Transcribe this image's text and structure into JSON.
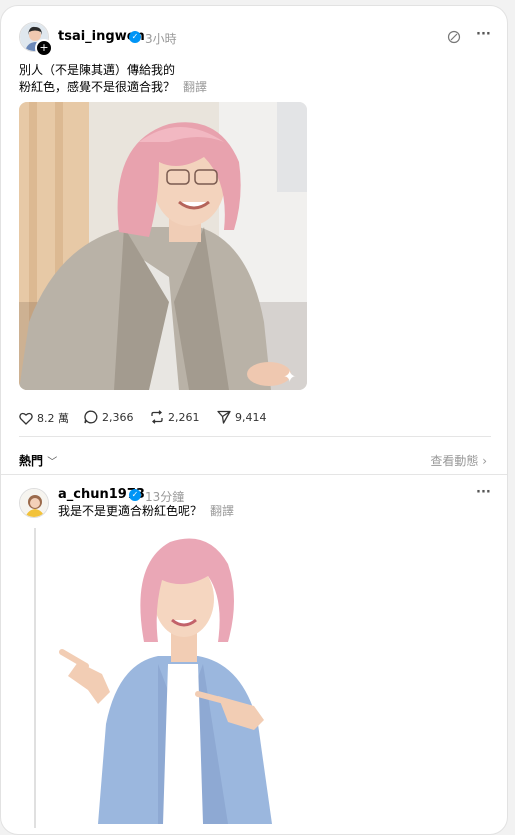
{
  "post": {
    "username": "tsai_ingwen",
    "time": "3小時",
    "text_line1": "別人（不是陳其邁）傳給我的",
    "text_line2": "粉紅色，感覺不是很適合我？",
    "translate": "翻譯",
    "likes": "8.2 萬",
    "comments": "2,366",
    "reposts": "2,261",
    "shares": "9,414"
  },
  "sort": {
    "label": "熱門",
    "activity": "查看動態"
  },
  "reply": {
    "username": "a_chun1973",
    "time": "13分鐘",
    "text": "我是不是更適合粉紅色呢？",
    "translate": "翻譯"
  },
  "colors": {
    "verified": "#0095f6",
    "muted": "#999999"
  }
}
